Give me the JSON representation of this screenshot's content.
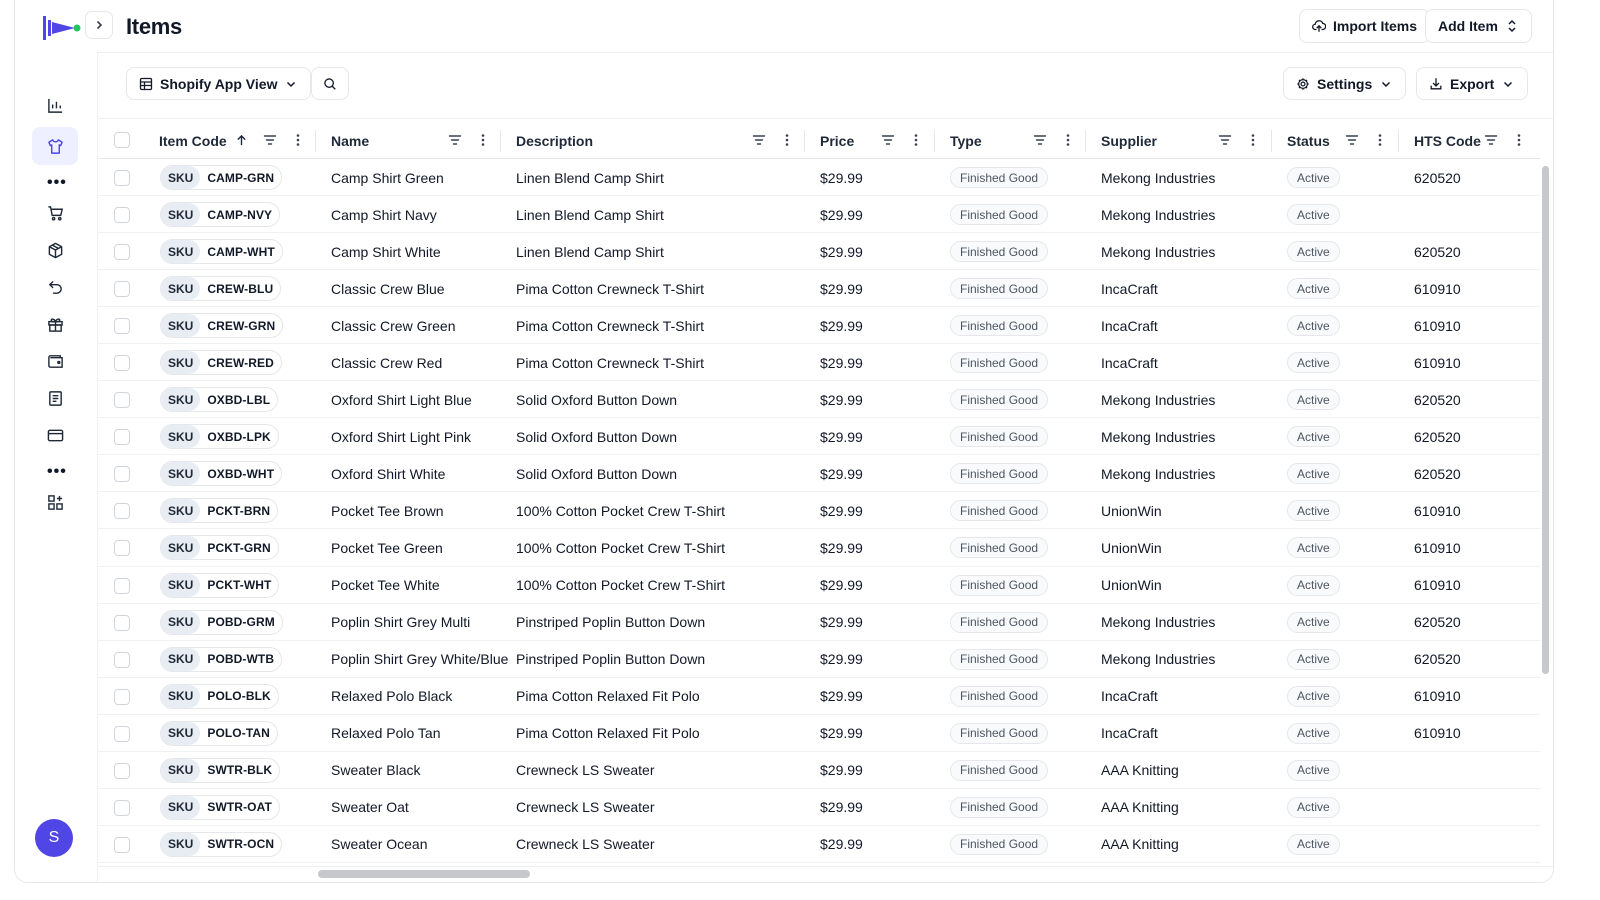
{
  "header": {
    "title": "Items",
    "import_label": "Import Items",
    "add_label": "Add Item"
  },
  "toolbar": {
    "view_label": "Shopify App View",
    "settings_label": "Settings",
    "export_label": "Export"
  },
  "sidebar": {
    "items": [
      "chart-icon",
      "shirt-icon",
      "cart-icon",
      "box-icon",
      "return-icon",
      "gift-icon",
      "wallet-icon",
      "document-icon",
      "card-icon",
      "apps-icon"
    ],
    "active": "shirt-icon",
    "avatar_initial": "S",
    "accent": "#5046e5"
  },
  "table": {
    "columns": [
      "Item Code",
      "Name",
      "Description",
      "Price",
      "Type",
      "Supplier",
      "Status",
      "HTS Code"
    ],
    "sort": {
      "column": "Item Code",
      "direction": "asc"
    },
    "sku_prefix": "SKU",
    "rows": [
      {
        "code": "CAMP-GRN",
        "name": "Camp Shirt Green",
        "desc": "Linen Blend Camp Shirt",
        "price": "$29.99",
        "type": "Finished Good",
        "supplier": "Mekong Industries",
        "status": "Active",
        "hts": "620520"
      },
      {
        "code": "CAMP-NVY",
        "name": "Camp Shirt Navy",
        "desc": "Linen Blend Camp Shirt",
        "price": "$29.99",
        "type": "Finished Good",
        "supplier": "Mekong Industries",
        "status": "Active",
        "hts": ""
      },
      {
        "code": "CAMP-WHT",
        "name": "Camp Shirt White",
        "desc": "Linen Blend Camp Shirt",
        "price": "$29.99",
        "type": "Finished Good",
        "supplier": "Mekong Industries",
        "status": "Active",
        "hts": "620520"
      },
      {
        "code": "CREW-BLU",
        "name": "Classic Crew Blue",
        "desc": "Pima Cotton Crewneck T-Shirt",
        "price": "$29.99",
        "type": "Finished Good",
        "supplier": "IncaCraft",
        "status": "Active",
        "hts": "610910"
      },
      {
        "code": "CREW-GRN",
        "name": "Classic Crew Green",
        "desc": "Pima Cotton Crewneck T-Shirt",
        "price": "$29.99",
        "type": "Finished Good",
        "supplier": "IncaCraft",
        "status": "Active",
        "hts": "610910"
      },
      {
        "code": "CREW-RED",
        "name": "Classic Crew Red",
        "desc": "Pima Cotton Crewneck T-Shirt",
        "price": "$29.99",
        "type": "Finished Good",
        "supplier": "IncaCraft",
        "status": "Active",
        "hts": "610910"
      },
      {
        "code": "OXBD-LBL",
        "name": "Oxford Shirt Light Blue",
        "desc": "Solid Oxford Button Down",
        "price": "$29.99",
        "type": "Finished Good",
        "supplier": "Mekong Industries",
        "status": "Active",
        "hts": "620520"
      },
      {
        "code": "OXBD-LPK",
        "name": "Oxford Shirt Light Pink",
        "desc": "Solid Oxford Button Down",
        "price": "$29.99",
        "type": "Finished Good",
        "supplier": "Mekong Industries",
        "status": "Active",
        "hts": "620520"
      },
      {
        "code": "OXBD-WHT",
        "name": "Oxford Shirt White",
        "desc": "Solid Oxford Button Down",
        "price": "$29.99",
        "type": "Finished Good",
        "supplier": "Mekong Industries",
        "status": "Active",
        "hts": "620520"
      },
      {
        "code": "PCKT-BRN",
        "name": "Pocket Tee Brown",
        "desc": "100% Cotton Pocket Crew T-Shirt",
        "price": "$29.99",
        "type": "Finished Good",
        "supplier": "UnionWin",
        "status": "Active",
        "hts": "610910"
      },
      {
        "code": "PCKT-GRN",
        "name": "Pocket Tee Green",
        "desc": "100% Cotton Pocket Crew T-Shirt",
        "price": "$29.99",
        "type": "Finished Good",
        "supplier": "UnionWin",
        "status": "Active",
        "hts": "610910"
      },
      {
        "code": "PCKT-WHT",
        "name": "Pocket Tee White",
        "desc": "100% Cotton Pocket Crew T-Shirt",
        "price": "$29.99",
        "type": "Finished Good",
        "supplier": "UnionWin",
        "status": "Active",
        "hts": "610910"
      },
      {
        "code": "POBD-GRM",
        "name": "Poplin Shirt Grey Multi",
        "desc": "Pinstriped Poplin Button Down",
        "price": "$29.99",
        "type": "Finished Good",
        "supplier": "Mekong Industries",
        "status": "Active",
        "hts": "620520"
      },
      {
        "code": "POBD-WTB",
        "name": "Poplin Shirt Grey White/Blue",
        "desc": "Pinstriped Poplin Button Down",
        "price": "$29.99",
        "type": "Finished Good",
        "supplier": "Mekong Industries",
        "status": "Active",
        "hts": "620520"
      },
      {
        "code": "POLO-BLK",
        "name": "Relaxed Polo Black",
        "desc": "Pima Cotton Relaxed Fit Polo",
        "price": "$29.99",
        "type": "Finished Good",
        "supplier": "IncaCraft",
        "status": "Active",
        "hts": "610910"
      },
      {
        "code": "POLO-TAN",
        "name": "Relaxed Polo Tan",
        "desc": "Pima Cotton Relaxed Fit Polo",
        "price": "$29.99",
        "type": "Finished Good",
        "supplier": "IncaCraft",
        "status": "Active",
        "hts": "610910"
      },
      {
        "code": "SWTR-BLK",
        "name": "Sweater Black",
        "desc": "Crewneck LS Sweater",
        "price": "$29.99",
        "type": "Finished Good",
        "supplier": "AAA Knitting",
        "status": "Active",
        "hts": ""
      },
      {
        "code": "SWTR-OAT",
        "name": "Sweater Oat",
        "desc": "Crewneck LS Sweater",
        "price": "$29.99",
        "type": "Finished Good",
        "supplier": "AAA Knitting",
        "status": "Active",
        "hts": ""
      },
      {
        "code": "SWTR-OCN",
        "name": "Sweater Ocean",
        "desc": "Crewneck LS Sweater",
        "price": "$29.99",
        "type": "Finished Good",
        "supplier": "AAA Knitting",
        "status": "Active",
        "hts": ""
      }
    ]
  }
}
